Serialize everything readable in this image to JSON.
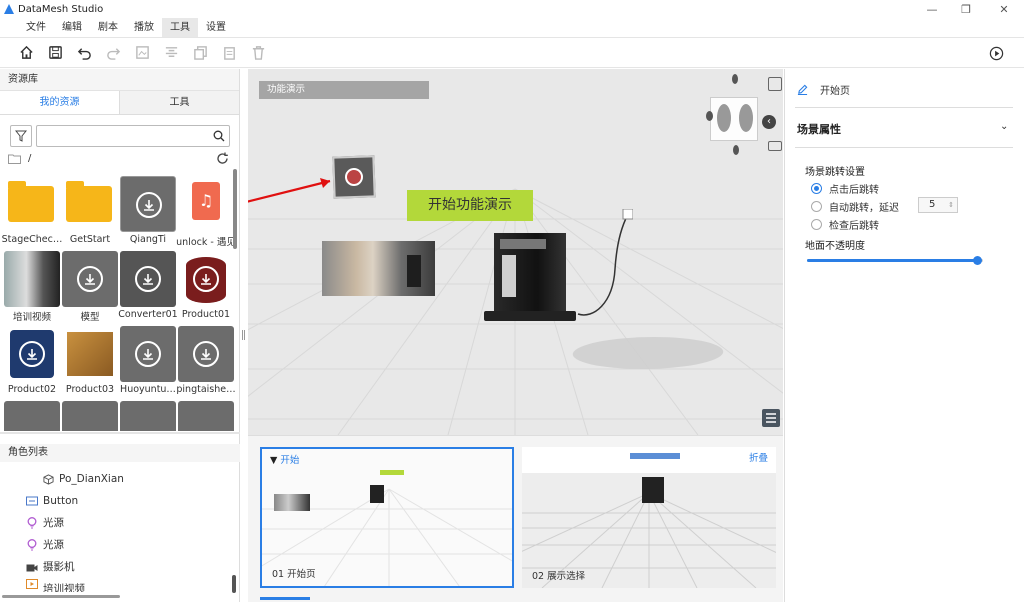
{
  "window": {
    "title": "DataMesh Studio"
  },
  "menu": [
    "文件",
    "编辑",
    "剧本",
    "播放",
    "工具",
    "设置"
  ],
  "toolbar_icons": [
    "home-icon",
    "save-icon",
    "undo-icon",
    "redo-icon",
    "image-icon",
    "align-icon",
    "copy-icon",
    "paste-icon",
    "delete-icon"
  ],
  "left": {
    "header": "资源库",
    "tabs": [
      "我的资源",
      "工具"
    ],
    "search": {
      "value": "",
      "placeholder": ""
    },
    "path": "/",
    "assets": [
      {
        "label": "StageChec…",
        "kind": "folder"
      },
      {
        "label": "GetStart",
        "kind": "folder"
      },
      {
        "label": "QiangTi",
        "kind": "download"
      },
      {
        "label": "unlock - 遇见",
        "kind": "audio"
      },
      {
        "label": "培训视频",
        "kind": "video"
      },
      {
        "label": "模型",
        "kind": "download"
      },
      {
        "label": "Converter01",
        "kind": "download"
      },
      {
        "label": "Product01",
        "kind": "download"
      },
      {
        "label": "Product02",
        "kind": "download"
      },
      {
        "label": "Product03",
        "kind": "box"
      },
      {
        "label": "Huoyuntu…",
        "kind": "download"
      },
      {
        "label": "pingtaishe…",
        "kind": "download"
      }
    ],
    "roles_header": "角色列表",
    "roles": [
      {
        "label": "Po_DianXian",
        "icon": "cube-icon"
      },
      {
        "label": "Button",
        "icon": "button-icon"
      },
      {
        "label": "光源",
        "icon": "light-icon"
      },
      {
        "label": "光源",
        "icon": "light-icon"
      },
      {
        "label": "摄影机",
        "icon": "camera-icon"
      },
      {
        "label": "培训视频",
        "icon": "video-icon"
      }
    ]
  },
  "viewport": {
    "label": "功能演示",
    "banner": "开始功能演示"
  },
  "scenes": [
    {
      "head": "开始",
      "foot": "01  开始页"
    },
    {
      "head": "",
      "foot": "02  展示选择",
      "fold": "折叠"
    }
  ],
  "right": {
    "page_name": "开始页",
    "section": "场景属性",
    "sub": "场景跳转设置",
    "options": [
      "点击后跳转",
      "自动跳转，延迟",
      "检查后跳转"
    ],
    "selected_option": 0,
    "delay": "5",
    "opacity_label": "地面不透明度",
    "opacity_value": 0.97
  },
  "colors": {
    "accent": "#2a7ee5",
    "banner": "#b3d83a"
  }
}
